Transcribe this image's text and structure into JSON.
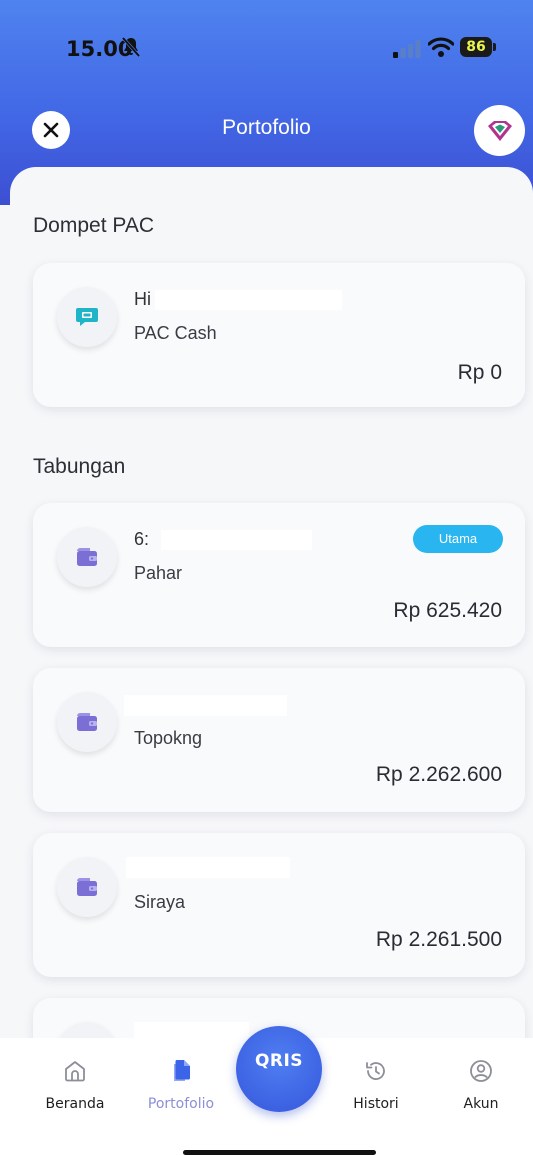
{
  "status_bar": {
    "time": "15.00",
    "battery": "86"
  },
  "header": {
    "title": "Portofolio"
  },
  "sections": {
    "dompet": {
      "title": "Dompet PAC",
      "card": {
        "line1": "Hi",
        "name": "PAC Cash",
        "amount": "Rp 0"
      }
    },
    "tabungan": {
      "title": "Tabungan",
      "cards": [
        {
          "line1": "6:",
          "name": "Pahar",
          "amount": "Rp 625.420",
          "badge": "Utama"
        },
        {
          "line1": "",
          "name": "Topokng",
          "amount": "Rp 2.262.600"
        },
        {
          "line1": "",
          "name": "Siraya",
          "amount": "Rp 2.261.500"
        }
      ]
    }
  },
  "bottom_nav": {
    "items": [
      {
        "label": "Beranda",
        "icon": "home-icon"
      },
      {
        "label": "Portofolio",
        "icon": "portfolio-icon"
      },
      {
        "label": "QRIS",
        "icon": "qris-icon"
      },
      {
        "label": "Histori",
        "icon": "history-icon"
      },
      {
        "label": "Akun",
        "icon": "account-icon"
      }
    ]
  },
  "colors": {
    "header_gradient_top": "#4f83ef",
    "header_gradient_bottom": "#3c4fd3",
    "badge": "#29b6f0",
    "active_nav": "#8c8ed8",
    "wallet_icon": "#7b6fd6"
  }
}
